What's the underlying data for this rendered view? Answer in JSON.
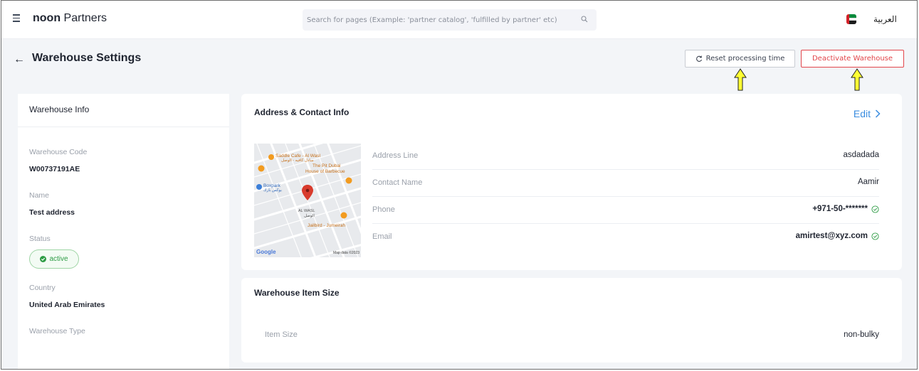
{
  "header": {
    "brand_bold": "noon",
    "brand_rest": "Partners",
    "search_placeholder": "Search for pages (Example: 'partner catalog', 'fulfilled by partner' etc)",
    "language": "العربية"
  },
  "page": {
    "title": "Warehouse Settings",
    "reset_button": "Reset processing time",
    "deactivate_button": "Deactivate Warehouse"
  },
  "warehouse_info": {
    "title": "Warehouse Info",
    "fields": [
      {
        "label": "Warehouse Code",
        "value": "W00737191AE"
      },
      {
        "label": "Name",
        "value": "Test address"
      },
      {
        "label": "Status",
        "value": "active"
      },
      {
        "label": "Country",
        "value": "United Arab Emirates"
      },
      {
        "label": "Warehouse Type",
        "value": ""
      }
    ]
  },
  "address_contact": {
    "title": "Address & Contact Info",
    "edit_label": "Edit",
    "rows": [
      {
        "label": "Address Line",
        "value": "asdadada",
        "verified": false
      },
      {
        "label": "Contact Name",
        "value": "Aamir",
        "verified": false
      },
      {
        "label": "Phone",
        "value": "+971-50-*******",
        "verified": true
      },
      {
        "label": "Email",
        "value": "amirtest@xyz.com",
        "verified": true
      }
    ],
    "map": {
      "poi_1": "Saddle Cafe - Al Wasl",
      "poi_1_ar": "سادل كافيه - الوصل",
      "poi_2a": "The Pit Dubai",
      "poi_2b": "House of Barbecue",
      "poi_3": "Boxpark",
      "poi_3_ar": "بوكس بارك",
      "area": "AL WASL",
      "area_ar": "الوصل",
      "poi_4": "Jailbird - Jumeirah",
      "logo": "Google",
      "attribution": "Map data ©2023"
    }
  },
  "item_size": {
    "title": "Warehouse Item Size",
    "label": "Item Size",
    "value": "non-bulky"
  },
  "colors": {
    "accent_link": "#3b8de0",
    "danger": "#e2454a",
    "success": "#2e9c45",
    "annotation_arrow": "#ffff33"
  }
}
